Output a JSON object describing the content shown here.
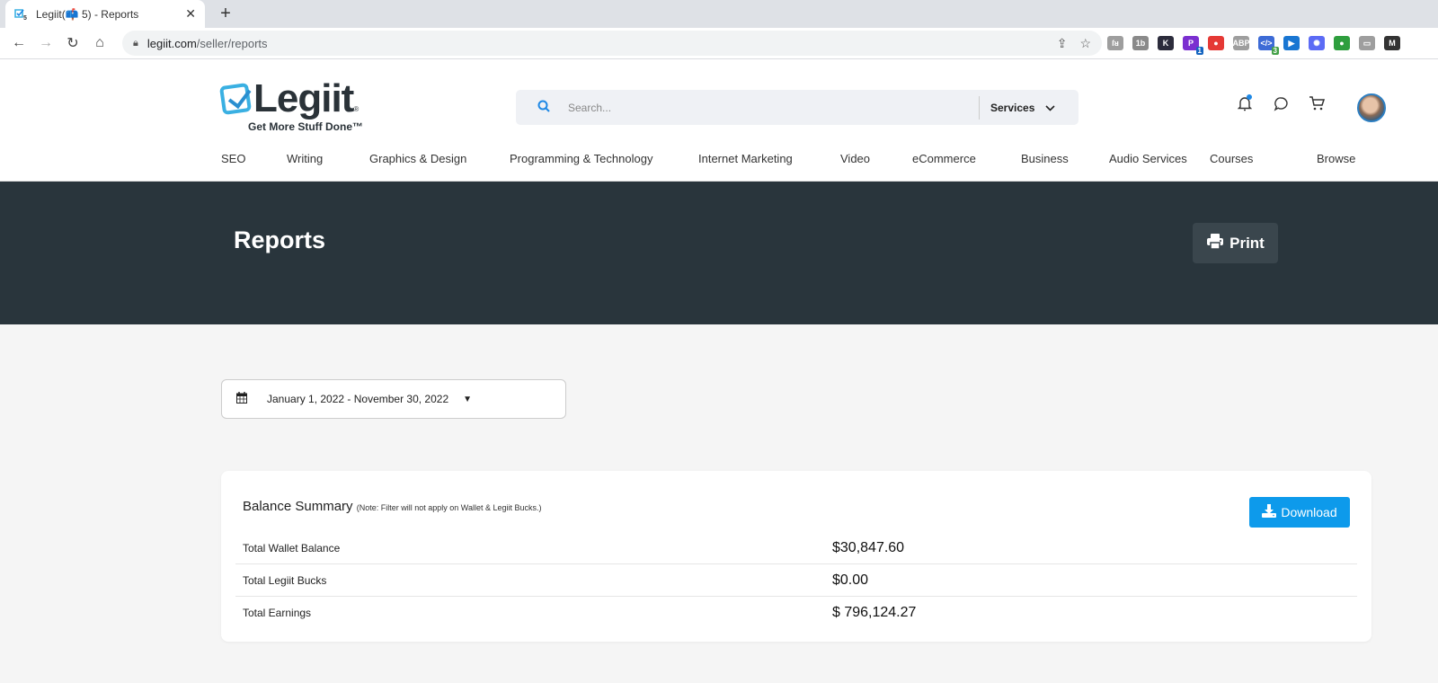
{
  "browser": {
    "tab_title": "Legiit(📫 5) - Reports",
    "favicon_badge": "5",
    "url_host": "legiit.com",
    "url_path": "/seller/reports",
    "extensions": [
      {
        "name": "extension-1",
        "glyph": "ſᴚ",
        "color": "#9e9e9e"
      },
      {
        "name": "extension-2",
        "glyph": "1b",
        "color": "#8a8a8a"
      },
      {
        "name": "extension-3",
        "glyph": "K",
        "color": "#2c2c3c"
      },
      {
        "name": "extension-4",
        "glyph": "P",
        "color": "#7b2fd0",
        "badge": "1",
        "badge_color": "#1565c0"
      },
      {
        "name": "extension-5",
        "glyph": "●",
        "color": "#e53935"
      },
      {
        "name": "extension-6",
        "glyph": "ABP",
        "color": "#9e9e9e"
      },
      {
        "name": "extension-7",
        "glyph": "</>",
        "color": "#3d6bd6",
        "badge": "3",
        "badge_color": "#43a047"
      },
      {
        "name": "extension-8",
        "glyph": "▶",
        "color": "#1976d2"
      },
      {
        "name": "extension-9",
        "glyph": "✺",
        "color": "#5c6bf5"
      },
      {
        "name": "extension-10",
        "glyph": "●",
        "color": "#2e9e3e"
      },
      {
        "name": "extension-11",
        "glyph": "▭",
        "color": "#9e9e9e"
      },
      {
        "name": "extension-12",
        "glyph": "M",
        "color": "#333333"
      }
    ]
  },
  "header": {
    "logo_name": "Legiit",
    "logo_reg": "®",
    "logo_tagline": "Get More Stuff Done™",
    "search_placeholder": "Search...",
    "search_category": "Services",
    "nav": [
      "SEO",
      "Writing",
      "Graphics & Design",
      "Programming & Technology",
      "Internet Marketing",
      "Video",
      "eCommerce",
      "Business",
      "Audio Services",
      "Courses",
      "Browse"
    ]
  },
  "hero": {
    "title": "Reports",
    "print_label": "Print"
  },
  "filter": {
    "date_range": "January 1, 2022 - November 30, 2022"
  },
  "balance_summary": {
    "title": "Balance Summary",
    "note": "(Note: Filter will not apply on Wallet & Legiit Bucks.)",
    "download_label": "Download",
    "rows": [
      {
        "label": "Total Wallet Balance",
        "value": "$30,847.60"
      },
      {
        "label": "Total Legiit Bucks",
        "value": "$0.00"
      },
      {
        "label": "Total Earnings",
        "value": "$ 796,124.27"
      }
    ]
  },
  "colors": {
    "accent": "#0d9aeb",
    "hero_bg": "#29353c",
    "print_bg": "#3a464d"
  }
}
